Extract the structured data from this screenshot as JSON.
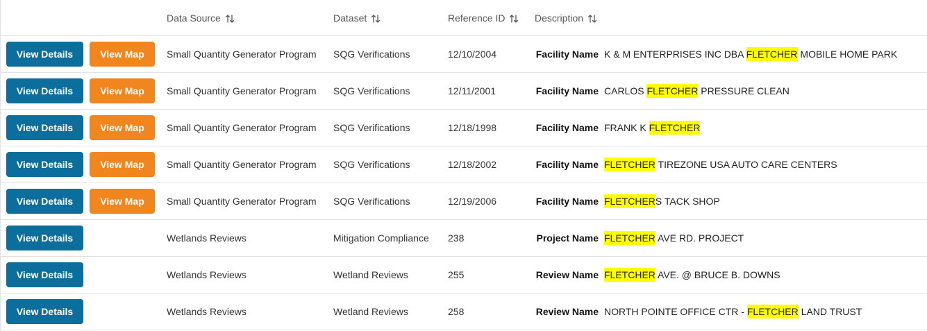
{
  "colors": {
    "details_button": "#0b6e9c",
    "map_button": "#f0861d",
    "highlight": "#ffff00"
  },
  "icons": {
    "sort": "sort-up-down-icon"
  },
  "table": {
    "headers": [
      {
        "key": "source",
        "label": "Data Source",
        "sortable": true
      },
      {
        "key": "dataset",
        "label": "Dataset",
        "sortable": true
      },
      {
        "key": "ref",
        "label": "Reference ID",
        "sortable": true
      },
      {
        "key": "description",
        "label": "Description",
        "sortable": true
      }
    ],
    "buttons": {
      "details": "View Details",
      "map": "View Map"
    },
    "rows": [
      {
        "has_map": true,
        "source": "Small Quantity Generator Program",
        "dataset": "SQG Verifications",
        "ref": "12/10/2004",
        "desc_label": "Facility Name",
        "desc": [
          {
            "text": "K & M ENTERPRISES INC DBA "
          },
          {
            "text": "FLETCHER",
            "highlight": true
          },
          {
            "text": " MOBILE HOME PARK"
          }
        ]
      },
      {
        "has_map": true,
        "source": "Small Quantity Generator Program",
        "dataset": "SQG Verifications",
        "ref": "12/11/2001",
        "desc_label": "Facility Name",
        "desc": [
          {
            "text": "CARLOS "
          },
          {
            "text": "FLETCHER",
            "highlight": true
          },
          {
            "text": " PRESSURE CLEAN"
          }
        ]
      },
      {
        "has_map": true,
        "source": "Small Quantity Generator Program",
        "dataset": "SQG Verifications",
        "ref": "12/18/1998",
        "desc_label": "Facility Name",
        "desc": [
          {
            "text": "FRANK K "
          },
          {
            "text": "FLETCHER",
            "highlight": true
          }
        ]
      },
      {
        "has_map": true,
        "source": "Small Quantity Generator Program",
        "dataset": "SQG Verifications",
        "ref": "12/18/2002",
        "desc_label": "Facility Name",
        "desc": [
          {
            "text": "FLETCHER",
            "highlight": true
          },
          {
            "text": " TIREZONE USA AUTO CARE CENTERS"
          }
        ]
      },
      {
        "has_map": true,
        "source": "Small Quantity Generator Program",
        "dataset": "SQG Verifications",
        "ref": "12/19/2006",
        "desc_label": "Facility Name",
        "desc": [
          {
            "text": "FLETCHER",
            "highlight": true
          },
          {
            "text": "S TACK SHOP"
          }
        ]
      },
      {
        "has_map": false,
        "source": "Wetlands Reviews",
        "dataset": "Mitigation Compliance",
        "ref": "238",
        "desc_label": "Project Name",
        "desc": [
          {
            "text": "FLETCHER",
            "highlight": true
          },
          {
            "text": " AVE RD. PROJECT"
          }
        ]
      },
      {
        "has_map": false,
        "source": "Wetlands Reviews",
        "dataset": "Wetland Reviews",
        "ref": "255",
        "desc_label": "Review Name",
        "desc": [
          {
            "text": "FLETCHER",
            "highlight": true
          },
          {
            "text": " AVE. @ BRUCE B. DOWNS"
          }
        ]
      },
      {
        "has_map": false,
        "source": "Wetlands Reviews",
        "dataset": "Wetland Reviews",
        "ref": "258",
        "desc_label": "Review Name",
        "desc": [
          {
            "text": "NORTH POINTE OFFICE CTR - "
          },
          {
            "text": "FLETCHER",
            "highlight": true
          },
          {
            "text": " LAND TRUST"
          }
        ]
      }
    ]
  }
}
